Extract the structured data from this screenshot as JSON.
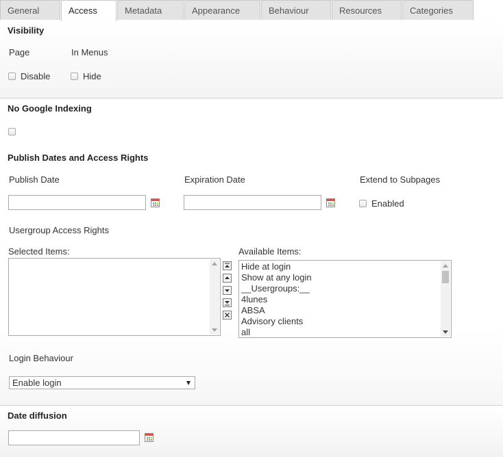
{
  "tabs": [
    {
      "label": "General"
    },
    {
      "label": "Access"
    },
    {
      "label": "Metadata"
    },
    {
      "label": "Appearance"
    },
    {
      "label": "Behaviour"
    },
    {
      "label": "Resources"
    },
    {
      "label": "Categories"
    }
  ],
  "active_tab": "Access",
  "visibility": {
    "heading": "Visibility",
    "page_label": "Page",
    "menus_label": "In Menus",
    "disable_label": "Disable",
    "hide_label": "Hide",
    "disable_checked": false,
    "hide_checked": false
  },
  "indexing": {
    "heading": "No Google Indexing",
    "checked": false
  },
  "publish": {
    "heading": "Publish Dates and Access Rights",
    "publish_date_label": "Publish Date",
    "publish_date_value": "",
    "expiration_date_label": "Expiration Date",
    "expiration_date_value": "",
    "extend_label": "Extend to Subpages",
    "enabled_label": "Enabled",
    "enabled_checked": false
  },
  "access_rights": {
    "heading": "Usergroup Access Rights",
    "selected_label": "Selected Items:",
    "available_label": "Available Items:",
    "selected_items": [],
    "available_items": [
      "Hide at login",
      "Show at any login",
      "__Usergroups:__",
      "4lunes",
      "ABSA",
      "Advisory clients",
      "all"
    ]
  },
  "login": {
    "heading": "Login Behaviour",
    "selected": "Enable login"
  },
  "date_diffusion": {
    "heading": "Date diffusion",
    "value": ""
  }
}
